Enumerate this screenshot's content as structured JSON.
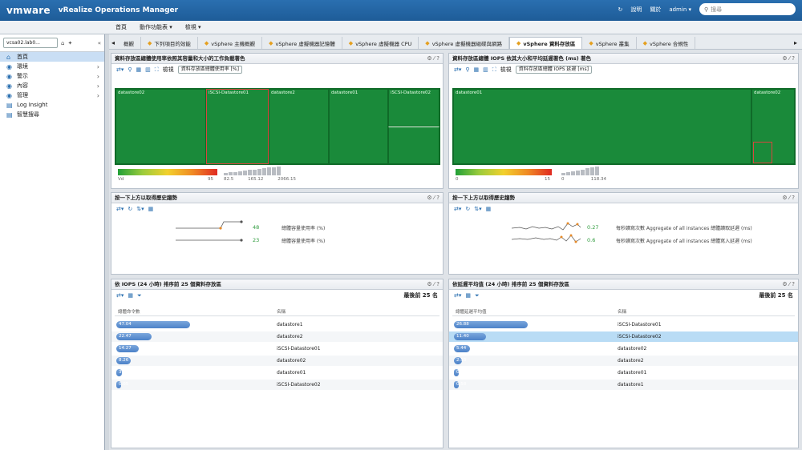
{
  "topbar": {
    "brand": "vmware",
    "app": "vRealize Operations Manager",
    "refresh": "↻",
    "help_label": "說明",
    "about_label": "關於",
    "user": "admin ▾",
    "search_placeholder": "搜尋"
  },
  "subbar": {
    "home": "首頁",
    "actions": "動作功能表 ▾",
    "views": "檢視 ▾"
  },
  "sidebar": {
    "select_value": "vcsa02.lab0...",
    "items": [
      {
        "label": "首頁",
        "icon": "⌂",
        "selected": true
      },
      {
        "label": "環境",
        "icon": "◉",
        "selected": false
      },
      {
        "label": "警示",
        "icon": "◉",
        "selected": false
      },
      {
        "label": "內容",
        "icon": "◉",
        "selected": false
      },
      {
        "label": "管理",
        "icon": "◉",
        "selected": false
      },
      {
        "label": "Log Insight",
        "icon": "▤",
        "selected": false
      },
      {
        "label": "智慧搜尋",
        "icon": "▤",
        "selected": false
      }
    ]
  },
  "tabs": [
    {
      "label": "概觀",
      "active": false
    },
    {
      "label": "下列項目的效能",
      "active": false
    },
    {
      "label": "vSphere 主機概觀",
      "active": false
    },
    {
      "label": "vSphere 虛擬機器記憶體",
      "active": false
    },
    {
      "label": "vSphere 虛擬機器 CPU",
      "active": false
    },
    {
      "label": "vSphere 虛擬機器磁碟與網路",
      "active": false
    },
    {
      "label": "vSphere 資料存放區",
      "active": true
    },
    {
      "label": "vSphere 叢集",
      "active": false
    },
    {
      "label": "vSphere 合規性",
      "active": false
    }
  ],
  "panels": {
    "p1": {
      "title": "資料存放區總體使用率依照其容量和大小的工作負載著色",
      "tools_label": "檢視",
      "dropdown": "資料存放區總體使用率 [%]"
    },
    "p2": {
      "title": "資料存放區總體 IOPS 依其大小和平均延遲著色 (ms) 著色",
      "tools_label": "檢視",
      "dropdown": "資料存放區總體 IOPS 延遲 [ms]"
    },
    "p3": {
      "title": "按一下上方以取得歷史趨勢"
    },
    "p4": {
      "title": "按一下上方以取得歷史趨勢"
    },
    "p5": {
      "title": "依 IOPS (24 小時) 排序前 25 個資料存放區",
      "count": "最後前 25 名",
      "col1": "總體命令數",
      "col2": "名稱"
    },
    "p6": {
      "title": "依延遲平均值 (24 小時) 排序前 25 個資料存放區",
      "count": "最後前 25 名",
      "col1": "總體延遲平均值",
      "col2": "名稱"
    }
  },
  "treemap1": {
    "labels": [
      "datastore02",
      "iSCSI-Datastore01",
      "datastore2",
      "datastore01",
      "iSCSI-Datastore02"
    ]
  },
  "treemap2": {
    "labels": [
      "datastore01",
      "datastore02"
    ]
  },
  "legend1": {
    "min": "Vd",
    "max": "95",
    "scale": [
      "82.5",
      "165.12",
      "2066.15"
    ]
  },
  "legend2": {
    "min": "0",
    "max": "15",
    "scale": [
      "0",
      "118.34"
    ]
  },
  "trend1": [
    {
      "value": "48",
      "label": "總體容量使用率 (%)"
    },
    {
      "value": "23",
      "label": "總體容量使用率 (%)"
    }
  ],
  "trend2": [
    {
      "value": "0.27",
      "label": "每秒讀寫次數 Aggregate of all instances 總體讀取延遲 (ms)"
    },
    {
      "value": "0.6",
      "label": "每秒讀寫次數 Aggregate of all instances 總體寫入延遲 (ms)"
    }
  ],
  "table1": [
    {
      "value": "47.04",
      "name": "datastore1",
      "pct": 0.92
    },
    {
      "value": "22.47",
      "name": "datastore2",
      "pct": 0.44
    },
    {
      "value": "14.27",
      "name": "iSCSI-Datastore01",
      "pct": 0.28
    },
    {
      "value": "8.26",
      "name": "datastore02",
      "pct": 0.18
    },
    {
      "value": "3.14",
      "name": "datastore01",
      "pct": 0.07
    },
    {
      "value": "0.05",
      "name": "iSCSI-Datastore02",
      "pct": 0.01
    }
  ],
  "table2": [
    {
      "value": "26.88",
      "name": "iSCSI-Datastore01",
      "pct": 0.92
    },
    {
      "value": "11.40",
      "name": "iSCSI-Datastore02",
      "pct": 0.4,
      "selected": true
    },
    {
      "value": "5.44",
      "name": "datastore02",
      "pct": 0.2
    },
    {
      "value": "2.53",
      "name": "datastore2",
      "pct": 0.1
    },
    {
      "value": "0.72",
      "name": "datastore01",
      "pct": 0.04
    },
    {
      "value": "0.58",
      "name": "datastore1",
      "pct": 0.03
    }
  ],
  "colors": {
    "accent": "#2a6fb0",
    "tree_green": "#1a8a3a",
    "selected_row": "#b9dcf5",
    "bar_blue": "#5b8fd0"
  }
}
